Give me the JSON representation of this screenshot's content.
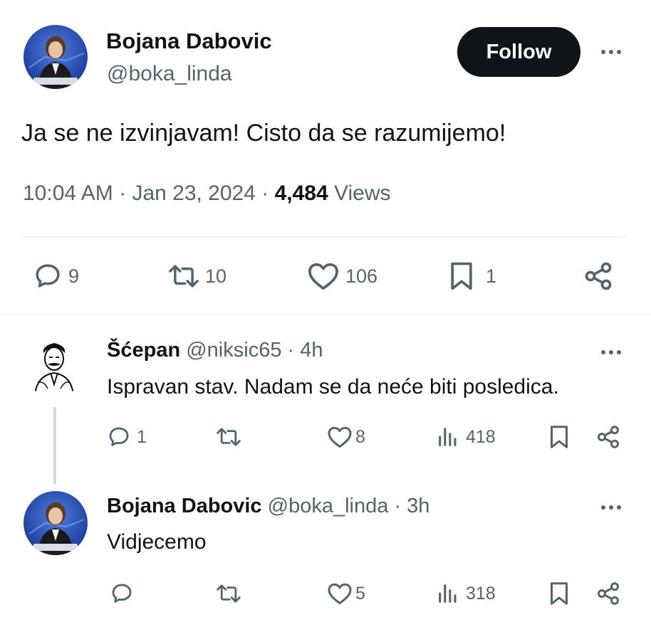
{
  "post": {
    "author_name": "Bojana Dabovic",
    "author_handle": "@boka_linda",
    "follow_label": "Follow",
    "text": "Ja se ne izvinjavam! Cisto da se razumijemo!",
    "time": "10:04 AM",
    "date": "Jan 23, 2024",
    "views_count": "4,484",
    "views_label": "Views",
    "replies": "9",
    "reposts": "10",
    "likes": "106",
    "bookmarks": "1"
  },
  "replies": [
    {
      "author_name": "Šćepan",
      "author_handle": "@niksic65",
      "age": "4h",
      "text": "Ispravan stav. Nadam se da neće biti posledica.",
      "replies": "1",
      "reposts": "",
      "likes": "8",
      "views": "418",
      "avatar": "engraved-portrait"
    },
    {
      "author_name": "Bojana Dabovic",
      "author_handle": "@boka_linda",
      "age": "3h",
      "text": "Vidjecemo",
      "replies": "",
      "reposts": "",
      "likes": "5",
      "views": "318",
      "avatar": "news-anchor"
    }
  ],
  "colors": {
    "text": "#0f1419",
    "secondary": "#536471",
    "follow_bg": "#0f1419",
    "avatar_bg": "#1a3fa8"
  }
}
